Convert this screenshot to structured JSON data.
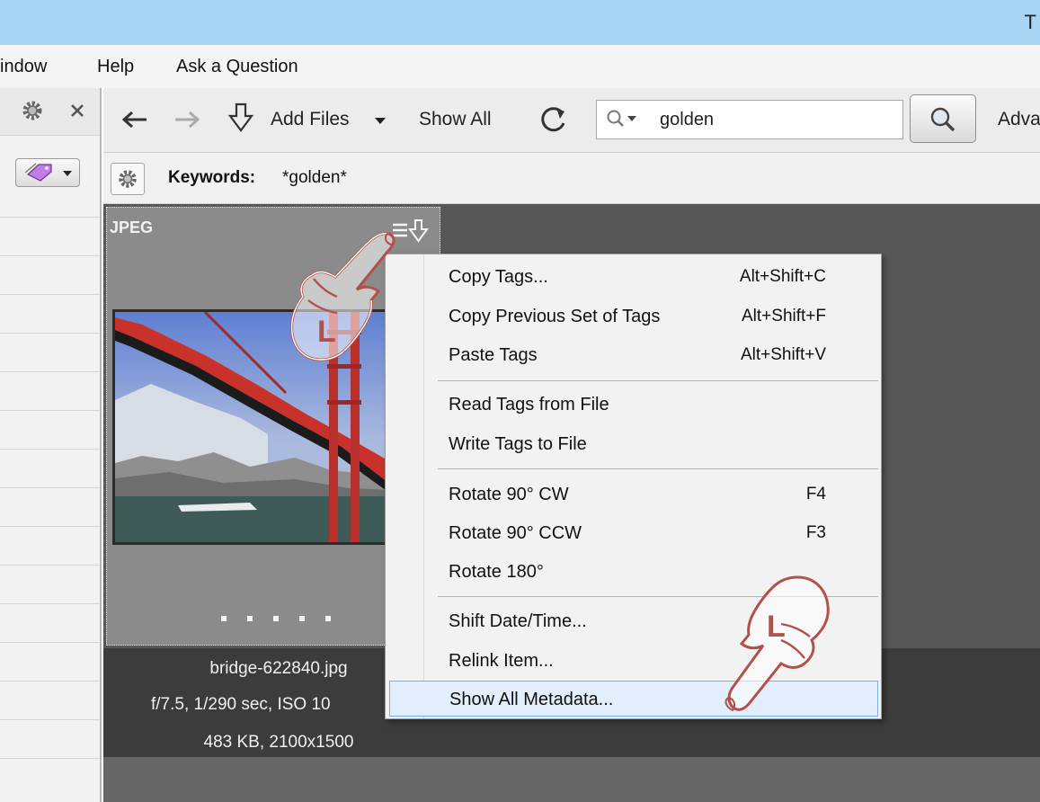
{
  "window": {
    "title_fragment": "T"
  },
  "menubar": {
    "items": [
      "indow",
      "Help",
      "Ask a Question"
    ]
  },
  "toolbar": {
    "add_files_label": "Add Files",
    "show_all_label": "Show All",
    "search_value": "golden",
    "advanced_fragment": "Adva"
  },
  "keyword_bar": {
    "label": "Keywords:",
    "value": "*golden*"
  },
  "thumbnail": {
    "format": "JPEG",
    "filename": "bridge-622840.jpg",
    "exif": "f/7.5, 1/290 sec, ISO 10",
    "size_info": "483 KB, 2100x1500"
  },
  "context_menu": {
    "items": [
      {
        "label": "Copy Tags...",
        "shortcut": "Alt+Shift+C"
      },
      {
        "label": "Copy Previous Set of Tags",
        "shortcut": "Alt+Shift+F"
      },
      {
        "label": "Paste Tags",
        "shortcut": "Alt+Shift+V"
      },
      {
        "label": "Read Tags from File",
        "shortcut": ""
      },
      {
        "label": "Write Tags to File",
        "shortcut": ""
      },
      {
        "label": "Rotate 90° CW",
        "shortcut": "F4"
      },
      {
        "label": "Rotate 90° CCW",
        "shortcut": "F3"
      },
      {
        "label": "Rotate 180°",
        "shortcut": ""
      },
      {
        "label": "Shift Date/Time...",
        "shortcut": ""
      },
      {
        "label": "Relink Item...",
        "shortcut": ""
      },
      {
        "label": "Show All Metadata...",
        "shortcut": ""
      }
    ],
    "highlighted": "Show All Metadata..."
  },
  "annotations": {
    "left_click_letter": "L"
  },
  "colors": {
    "titlebar": "#a9d5f5",
    "menu_highlight": "#e2eefb",
    "menu_highlight_border": "#7ab0e4",
    "hand_outline": "#b2504a"
  }
}
